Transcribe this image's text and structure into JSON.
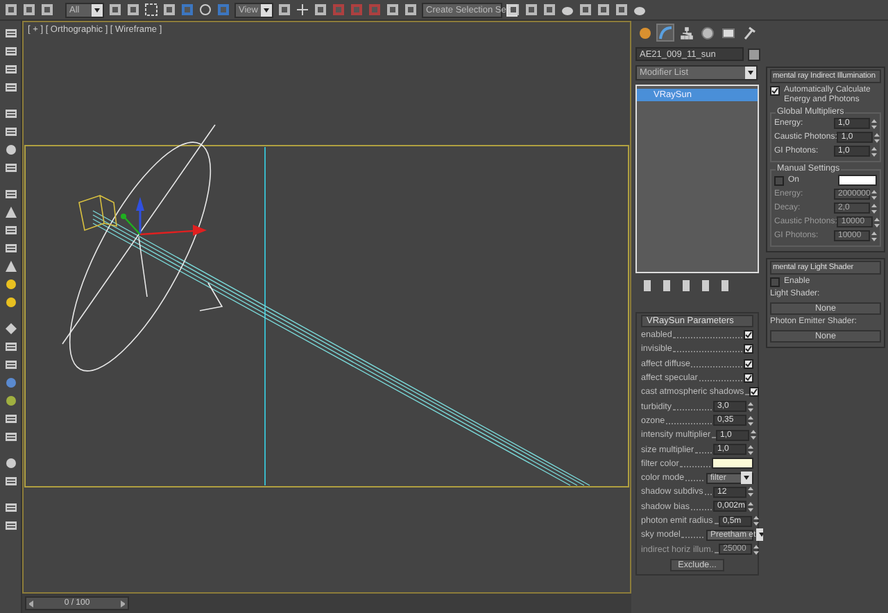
{
  "toolbar": {
    "selection_filter": "All",
    "reference_coord": "View",
    "named_selection": "Create Selection Se"
  },
  "viewport": {
    "label": "[ + ] [ Orthographic ] [ Wireframe ]"
  },
  "timeline": {
    "frame": "0 / 100",
    "level": 0
  },
  "command_panel": {
    "tabs": [
      {
        "selected": false
      },
      {
        "selected": true
      },
      {
        "selected": false
      },
      {
        "selected": false
      },
      {
        "selected": false
      },
      {
        "selected": false
      }
    ],
    "object_name": "AE21_009_11_sun",
    "modifier_list": "Modifier List",
    "stack": [
      {
        "label": "VRaySun",
        "selected": true
      }
    ],
    "rollout_title": "VRaySun Parameters",
    "params": [
      {
        "kind": "checkbox",
        "label": "enabled",
        "checked": true
      },
      {
        "kind": "checkbox",
        "label": "invisible",
        "checked": true
      },
      {
        "kind": "checkbox",
        "label": "affect diffuse",
        "checked": true
      },
      {
        "kind": "checkbox",
        "label": "affect specular",
        "checked": true
      },
      {
        "kind": "checkbox",
        "label": "cast atmospheric shadows",
        "checked": true
      },
      {
        "kind": "spinner",
        "label": "turbidity",
        "value": "3,0",
        "disabled": false
      },
      {
        "kind": "spinner",
        "label": "ozone",
        "value": "0,35",
        "disabled": false
      },
      {
        "kind": "spinner",
        "label": "intensity multiplier",
        "value": "1,0",
        "disabled": false
      },
      {
        "kind": "spinner",
        "label": "size multiplier",
        "value": "1,0",
        "disabled": false
      },
      {
        "kind": "color",
        "label": "filter color",
        "color": "#fcfad8"
      },
      {
        "kind": "dropdown",
        "label": "color mode",
        "value": "filter"
      },
      {
        "kind": "spinner",
        "label": "shadow subdivs",
        "value": "12",
        "disabled": false
      },
      {
        "kind": "spinner",
        "label": "shadow bias",
        "value": "0,002m",
        "disabled": false
      },
      {
        "kind": "spinner",
        "label": "photon emit radius",
        "value": "0,5m",
        "disabled": false
      },
      {
        "kind": "dropdown",
        "label": "sky model",
        "value": "Preetham et"
      },
      {
        "kind": "spinner",
        "label": "indirect horiz illum.",
        "value": "25000",
        "disabled": true
      },
      {
        "kind": "button",
        "label": "Exclude..."
      }
    ]
  },
  "mental_ray": {
    "title": "mental ray Indirect Illumination",
    "auto_calculate": {
      "label": "Automatically Calculate Energy and Photons",
      "checked": true
    },
    "global_title": "Global Multipliers",
    "global": [
      {
        "label": "Energy:",
        "value": "1,0",
        "disabled": false
      },
      {
        "label": "Caustic Photons:",
        "value": "1,0",
        "disabled": false
      },
      {
        "label": "GI Photons:",
        "value": "1,0",
        "disabled": false
      }
    ],
    "manual_title": "Manual Settings",
    "manual_on": {
      "label": "On",
      "checked": false
    },
    "manual": [
      {
        "label": "Energy:",
        "value": "2000000",
        "disabled": true
      },
      {
        "label": "Decay:",
        "value": "2,0",
        "disabled": true
      },
      {
        "label": "Caustic Photons:",
        "value": "10000",
        "disabled": true
      },
      {
        "label": "GI Photons:",
        "value": "10000",
        "disabled": true
      }
    ],
    "shader_title": "mental ray Light Shader",
    "enable": {
      "label": "Enable",
      "checked": false
    },
    "light_shader_label": "Light Shader:",
    "light_shader": "None",
    "photon_shader_label": "Photon Emitter Shader:",
    "photon_shader": "None"
  }
}
